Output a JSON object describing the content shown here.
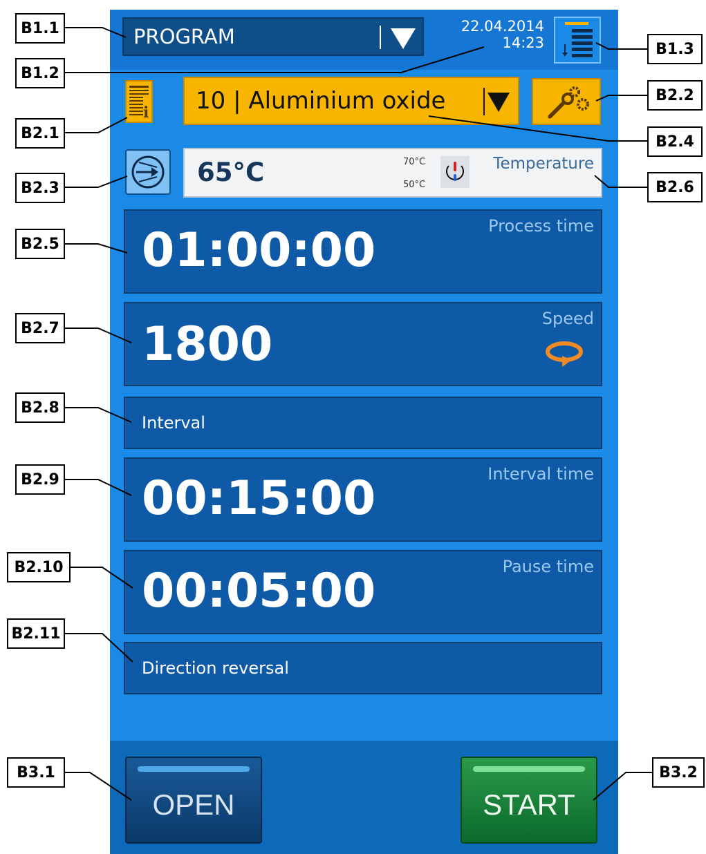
{
  "header": {
    "program_label": "PROGRAM",
    "date": "22.04.2014",
    "time": "14:23"
  },
  "material": {
    "label": "10 | Aluminium oxide"
  },
  "temperature": {
    "value": "65°C",
    "upper_limit": "70°C",
    "lower_limit": "50°C",
    "label": "Temperature"
  },
  "process_time": {
    "title": "Process time",
    "value": "01:00:00"
  },
  "speed": {
    "title": "Speed",
    "value": "1800"
  },
  "interval": {
    "label": "Interval"
  },
  "interval_time": {
    "title": "Interval time",
    "value": "00:15:00"
  },
  "pause_time": {
    "title": "Pause time",
    "value": "00:05:00"
  },
  "direction_reversal": {
    "label": "Direction reversal"
  },
  "footer": {
    "open_label": "OPEN",
    "start_label": "START"
  },
  "callouts": {
    "b1_1": "B1.1",
    "b1_2": "B1.2",
    "b1_3": "B1.3",
    "b2_1": "B2.1",
    "b2_2": "B2.2",
    "b2_3": "B2.3",
    "b2_4": "B2.4",
    "b2_5": "B2.5",
    "b2_6": "B2.6",
    "b2_7": "B2.7",
    "b2_8": "B2.8",
    "b2_9": "B2.9",
    "b2_10": "B2.10",
    "b2_11": "B2.11",
    "b3_1": "B3.1",
    "b3_2": "B3.2"
  },
  "colors": {
    "screen_bg": "#1a8ae6",
    "panel_bg": "#0e5aa6",
    "accent_orange": "#f7b500",
    "start_green": "#0b6a2c",
    "speed_icon": "#f08a24"
  },
  "icons": [
    "dropdown-arrow-icon",
    "list-download-icon",
    "info-document-icon",
    "settings-tools-icon",
    "pump-icon",
    "thermostat-icon",
    "rotation-icon"
  ]
}
